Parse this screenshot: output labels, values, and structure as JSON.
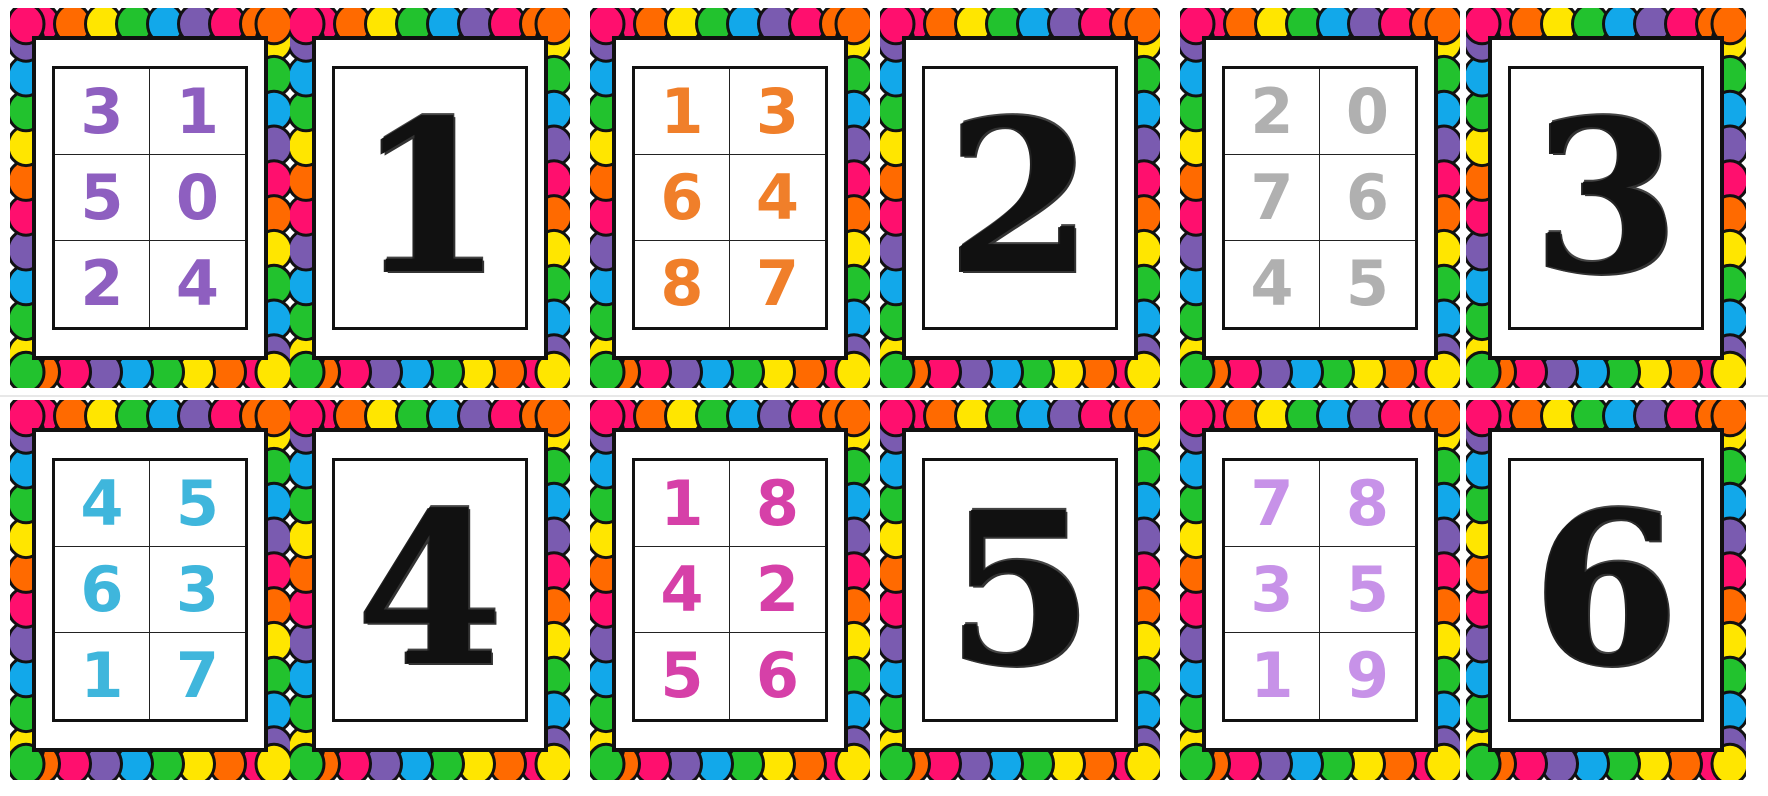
{
  "scallop_colors": [
    "#ff0f6e",
    "#ff6a00",
    "#ffe600",
    "#22c22e",
    "#12a8ea",
    "#7a5bb0"
  ],
  "ink": "#111111",
  "cards": [
    {
      "kind": "grid",
      "color": "#8e5fc0",
      "digits": [
        "3",
        "1",
        "5",
        "0",
        "2",
        "4"
      ]
    },
    {
      "kind": "big",
      "digit": "1"
    },
    {
      "kind": "grid",
      "color": "#f07f2a",
      "digits": [
        "1",
        "3",
        "6",
        "4",
        "8",
        "7"
      ]
    },
    {
      "kind": "big",
      "digit": "2"
    },
    {
      "kind": "grid",
      "color": "#b0b0b0",
      "digits": [
        "2",
        "0",
        "7",
        "6",
        "4",
        "5"
      ]
    },
    {
      "kind": "big",
      "digit": "3"
    },
    {
      "kind": "grid",
      "color": "#3fb6dc",
      "digits": [
        "4",
        "5",
        "6",
        "3",
        "1",
        "7"
      ]
    },
    {
      "kind": "big",
      "digit": "4"
    },
    {
      "kind": "grid",
      "color": "#d640a8",
      "digits": [
        "1",
        "8",
        "4",
        "2",
        "5",
        "6"
      ]
    },
    {
      "kind": "big",
      "digit": "5"
    },
    {
      "kind": "grid",
      "color": "#c792e8",
      "digits": [
        "7",
        "8",
        "3",
        "5",
        "1",
        "9"
      ]
    },
    {
      "kind": "big",
      "digit": "6"
    }
  ]
}
